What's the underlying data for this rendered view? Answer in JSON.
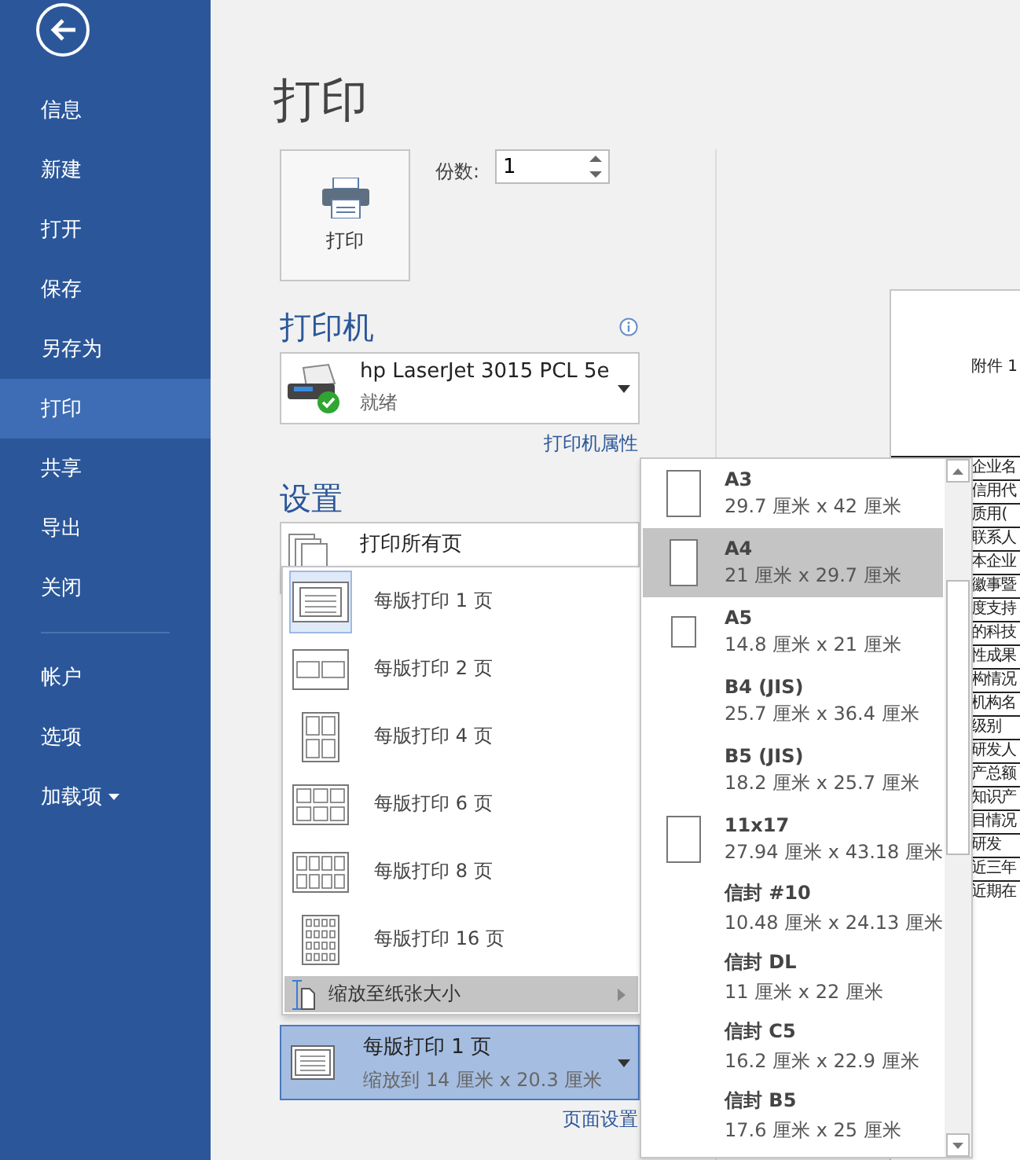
{
  "sidebar": {
    "items": [
      {
        "label": "信息",
        "selected": false,
        "has_menu": false
      },
      {
        "label": "新建",
        "selected": false,
        "has_menu": false
      },
      {
        "label": "打开",
        "selected": false,
        "has_menu": false
      },
      {
        "label": "保存",
        "selected": false,
        "has_menu": false
      },
      {
        "label": "另存为",
        "selected": false,
        "has_menu": false
      },
      {
        "label": "打印",
        "selected": true,
        "has_menu": false
      },
      {
        "label": "共享",
        "selected": false,
        "has_menu": false
      },
      {
        "label": "导出",
        "selected": false,
        "has_menu": false
      },
      {
        "label": "关闭",
        "selected": false,
        "has_menu": false
      }
    ],
    "bottom_items": [
      {
        "label": "帐户",
        "selected": false,
        "has_menu": false
      },
      {
        "label": "选项",
        "selected": false,
        "has_menu": false
      },
      {
        "label": "加载项",
        "selected": false,
        "has_menu": true
      }
    ]
  },
  "title": "打印",
  "print_button": {
    "label": "打印"
  },
  "copies": {
    "label": "份数:",
    "value": "1"
  },
  "printer": {
    "heading": "打印机",
    "name": "hp LaserJet 3015 PCL 5e",
    "status": "就绪",
    "properties_link": "打印机属性"
  },
  "settings": {
    "heading": "设置",
    "print_range": "打印所有页",
    "pages_per_sheet_menu": [
      {
        "label": "每版打印 1 页",
        "kind": "one",
        "selected": true
      },
      {
        "label": "每版打印 2 页",
        "kind": "two",
        "selected": false
      },
      {
        "label": "每版打印 4 页",
        "kind": "four",
        "selected": false
      },
      {
        "label": "每版打印 6 页",
        "kind": "six",
        "selected": false
      },
      {
        "label": "每版打印 8 页",
        "kind": "eight",
        "selected": false
      },
      {
        "label": "每版打印 16 页",
        "kind": "sixteen",
        "selected": false
      }
    ],
    "scale_submenu": {
      "label": "缩放至纸张大小",
      "selected": true
    },
    "pages_per_sheet": {
      "label": "每版打印 1 页",
      "detail": "缩放到 14 厘米 x 20.3 厘米"
    },
    "page_setup_link": "页面设置"
  },
  "paper_menu": [
    {
      "name": "A3",
      "size": "29.7 厘米 x 42 厘米",
      "kind": "large",
      "selected": false
    },
    {
      "name": "A4",
      "size": "21 厘米 x 29.7 厘米",
      "kind": "medium",
      "selected": true
    },
    {
      "name": "A5",
      "size": "14.8 厘米 x 21 厘米",
      "kind": "small",
      "selected": false
    },
    {
      "name": "B4 (JIS)",
      "size": "25.7 厘米 x 36.4 厘米",
      "kind": "none",
      "selected": false
    },
    {
      "name": "B5 (JIS)",
      "size": "18.2 厘米 x 25.7 厘米",
      "kind": "none",
      "selected": false
    },
    {
      "name": "11x17",
      "size": "27.94 厘米 x 43.18 厘米",
      "kind": "large",
      "selected": false
    },
    {
      "name": "信封 #10",
      "size": "10.48 厘米 x 24.13 厘米",
      "kind": "none",
      "selected": false
    },
    {
      "name": "信封 DL",
      "size": "11 厘米 x 22 厘米",
      "kind": "none",
      "selected": false
    },
    {
      "name": "信封 C5",
      "size": "16.2 厘米 x 22.9 厘米",
      "kind": "none",
      "selected": false
    },
    {
      "name": "信封 B5",
      "size": "17.6 厘米 x 25 厘米",
      "kind": "none",
      "selected": false
    }
  ],
  "preview": {
    "heading": "附件 1",
    "table_rows": [
      "企业名",
      "信用代",
      "质用(",
      "联系人",
      "本企业",
      "徽事暨",
      "度支持",
      "的科技",
      "性成果",
      "构情况",
      "机构名",
      "级别",
      "研发人",
      "产总额",
      "知识产",
      "目情况",
      "研发",
      "近三年",
      "近期在"
    ]
  }
}
